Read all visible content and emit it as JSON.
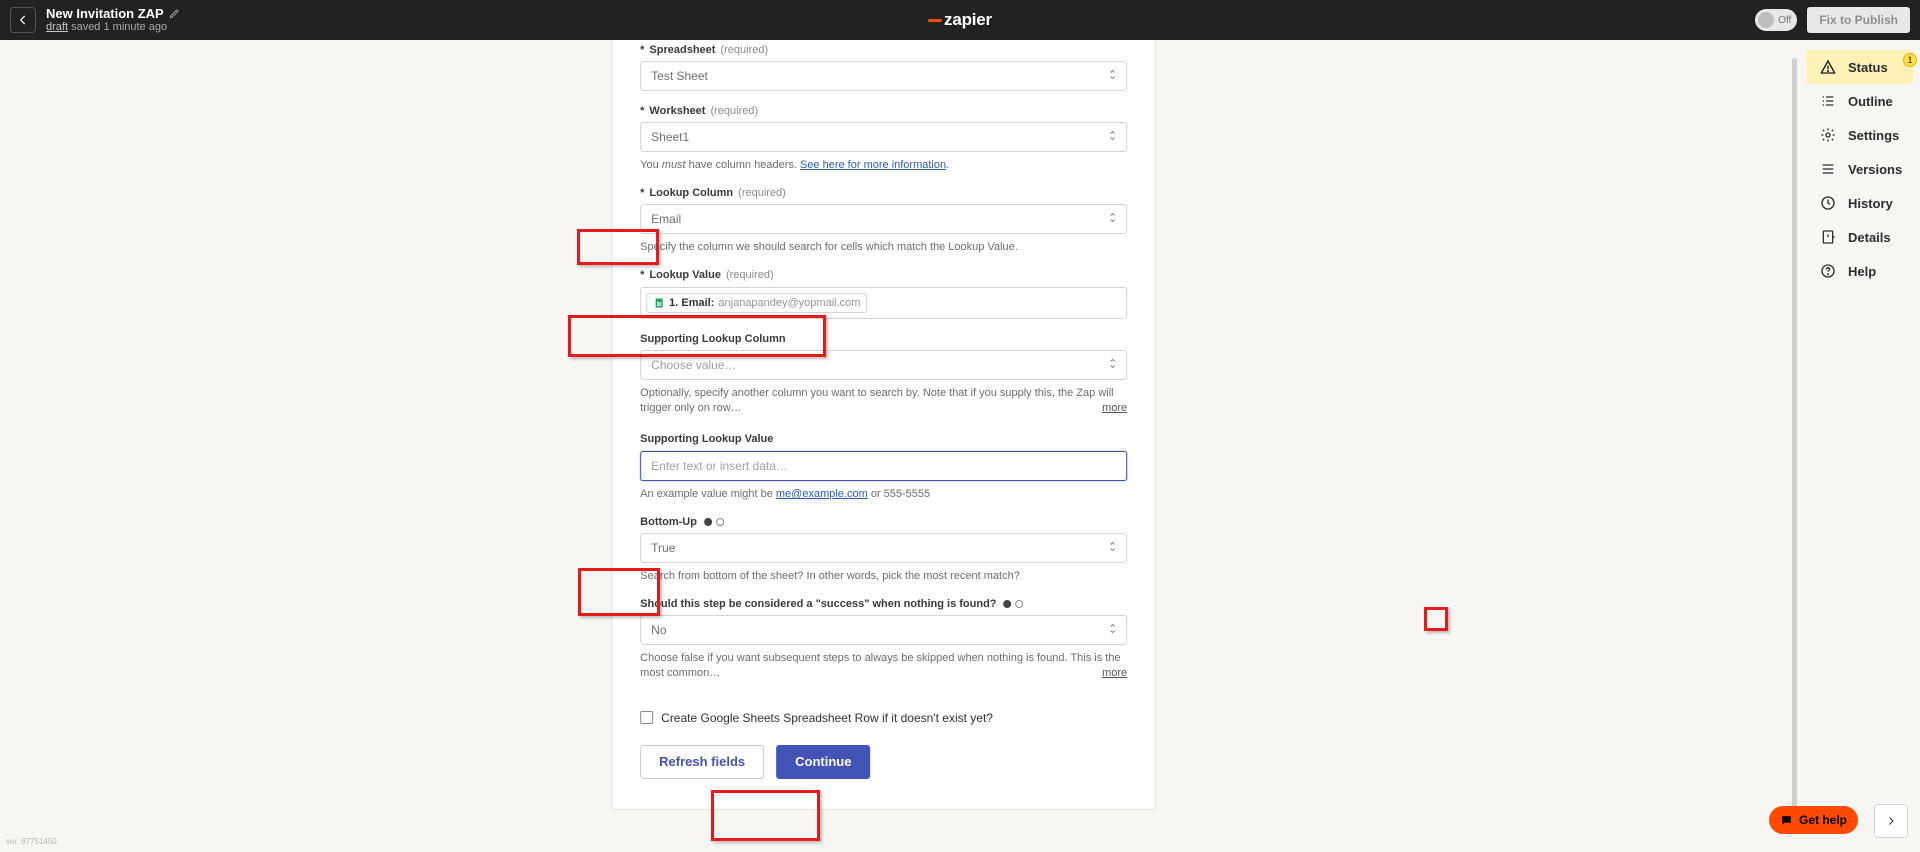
{
  "topbar": {
    "title": "New Invitation ZAP",
    "status_link": "draft",
    "status_text": " saved 1 minute ago",
    "toggle_label": "Off",
    "publish_label": "Fix to Publish",
    "logo_text": "zapier"
  },
  "rightnav": {
    "items": [
      {
        "label": "Status",
        "badge": "1"
      },
      {
        "label": "Outline"
      },
      {
        "label": "Settings"
      },
      {
        "label": "Versions"
      },
      {
        "label": "History"
      },
      {
        "label": "Details"
      },
      {
        "label": "Help"
      }
    ]
  },
  "help_button": "Get help",
  "panel": {
    "spreadsheet": {
      "label": "Spreadsheet",
      "req": "(required)",
      "value": "Test Sheet"
    },
    "worksheet": {
      "label": "Worksheet",
      "req": "(required)",
      "value": "Sheet1",
      "helper_pre": "You ",
      "helper_em": "must",
      "helper_post": " have column headers. ",
      "helper_link": "See here for more information"
    },
    "lookup_column": {
      "label": "Lookup Column",
      "req": "(required)",
      "value": "Email",
      "helper": "Specify the column we should search for cells which match the Lookup Value."
    },
    "lookup_value": {
      "label": "Lookup Value",
      "req": "(required)",
      "token_bold": "1. Email:",
      "token_light": "anjanapandey@yopmail.com"
    },
    "supporting_lookup_column": {
      "label": "Supporting Lookup Column",
      "placeholder": "Choose value…",
      "helper": "Optionally, specify another column you want to search by. Note that if you supply this, the Zap will trigger only on row…",
      "more": "more"
    },
    "supporting_lookup_value": {
      "label": "Supporting Lookup Value",
      "placeholder": "Enter text or insert data…",
      "helper_pre": "An example value might be ",
      "helper_link": "me@example.com",
      "helper_post": " or 555-5555"
    },
    "bottom_up": {
      "label": "Bottom-Up",
      "value": "True",
      "helper": "Search from bottom of the sheet? In other words, pick the most recent match?"
    },
    "success_nothing": {
      "label": "Should this step be considered a \"success\" when nothing is found?",
      "value": "No",
      "helper": "Choose false if you want subsequent steps to always be skipped when nothing is found. This is the most common…",
      "more": "more"
    },
    "create_row_checkbox": "Create Google Sheets Spreadsheet Row if it doesn't exist yet?",
    "refresh_button": "Refresh fields",
    "continue_button": "Continue"
  },
  "version": "ver. 97751450"
}
